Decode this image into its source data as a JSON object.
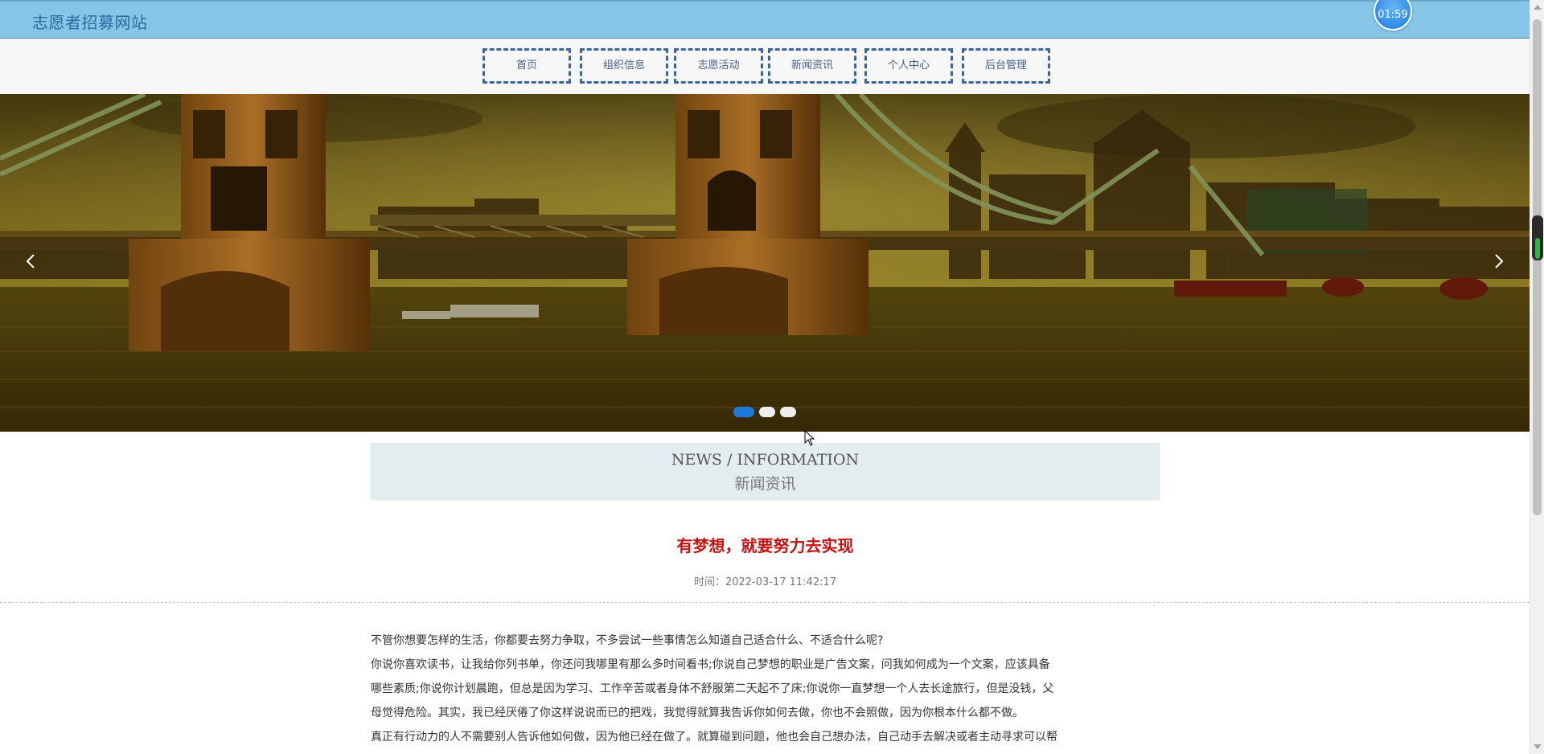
{
  "header": {
    "site_title": "志愿者招募网站",
    "timer": "01:59"
  },
  "nav": {
    "items": [
      {
        "label": "首页"
      },
      {
        "label": "组织信息"
      },
      {
        "label": "志愿活动"
      },
      {
        "label": "新闻资讯"
      },
      {
        "label": "个人中心"
      },
      {
        "label": "后台管理"
      }
    ],
    "border_color": "#3a659a"
  },
  "banner": {
    "slide_count": 3,
    "active_slide": 1,
    "active_dot_color": "#1e7ad8",
    "inactive_dot_color": "#eeeeee",
    "prev_icon": "chevron-left-icon",
    "next_icon": "chevron-right-icon"
  },
  "section": {
    "title_en": "NEWS / INFORMATION",
    "title_cn": "新闻资讯"
  },
  "article": {
    "title": "有梦想，就要努力去实现",
    "time": "时间：2022-03-17 11:42:17",
    "title_color": "#c81010",
    "paragraphs": [
      "不管你想要怎样的生活，你都要去努力争取，不多尝试一些事情怎么知道自己适合什么、不适合什么呢?",
      "你说你喜欢读书，让我给你列书单，你还问我哪里有那么多时间看书;你说自己梦想的职业是广告文案，问我如何成为一个文案，应该具备",
      "哪些素质;你说你计划晨跑，但总是因为学习、工作辛苦或者身体不舒服第二天起不了床;你说你一直梦想一个人去长途旅行，但是没钱，父",
      "母觉得危险。其实，我已经厌倦了你这样说说而已的把戏，我觉得就算我告诉你如何去做，你也不会照做，因为你根本什么都不做。",
      "真正有行动力的人不需要别人告诉他如何做，因为他已经在做了。就算碰到问题，他也会自己想办法，自己动手去解决或者主动寻求可以帮"
    ]
  }
}
